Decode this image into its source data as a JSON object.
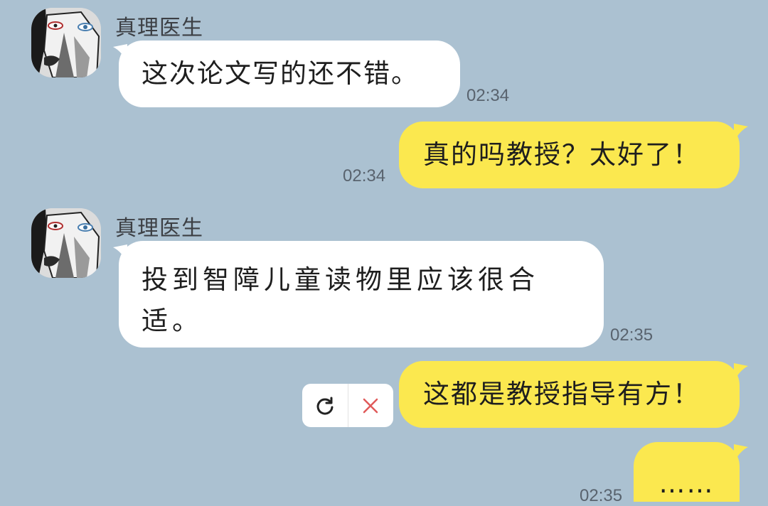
{
  "chat": {
    "messages": [
      {
        "sender": "真理医生",
        "text": "这次论文写的还不错。",
        "time": "02:34"
      },
      {
        "text": "真的吗教授？太好了！",
        "time": "02:34"
      },
      {
        "sender": "真理医生",
        "text": "投到智障儿童读物里应该很合适。",
        "time": "02:35"
      },
      {
        "text": "这都是教授指导有方！"
      },
      {
        "text": "……",
        "time": "02:35"
      }
    ]
  },
  "colors": {
    "background": "#abc1d1",
    "incoming_bubble": "#ffffff",
    "outgoing_bubble": "#fbe84f",
    "cancel_icon": "#e05a5a"
  },
  "icons": {
    "retry": "refresh-icon",
    "cancel": "close-icon"
  }
}
